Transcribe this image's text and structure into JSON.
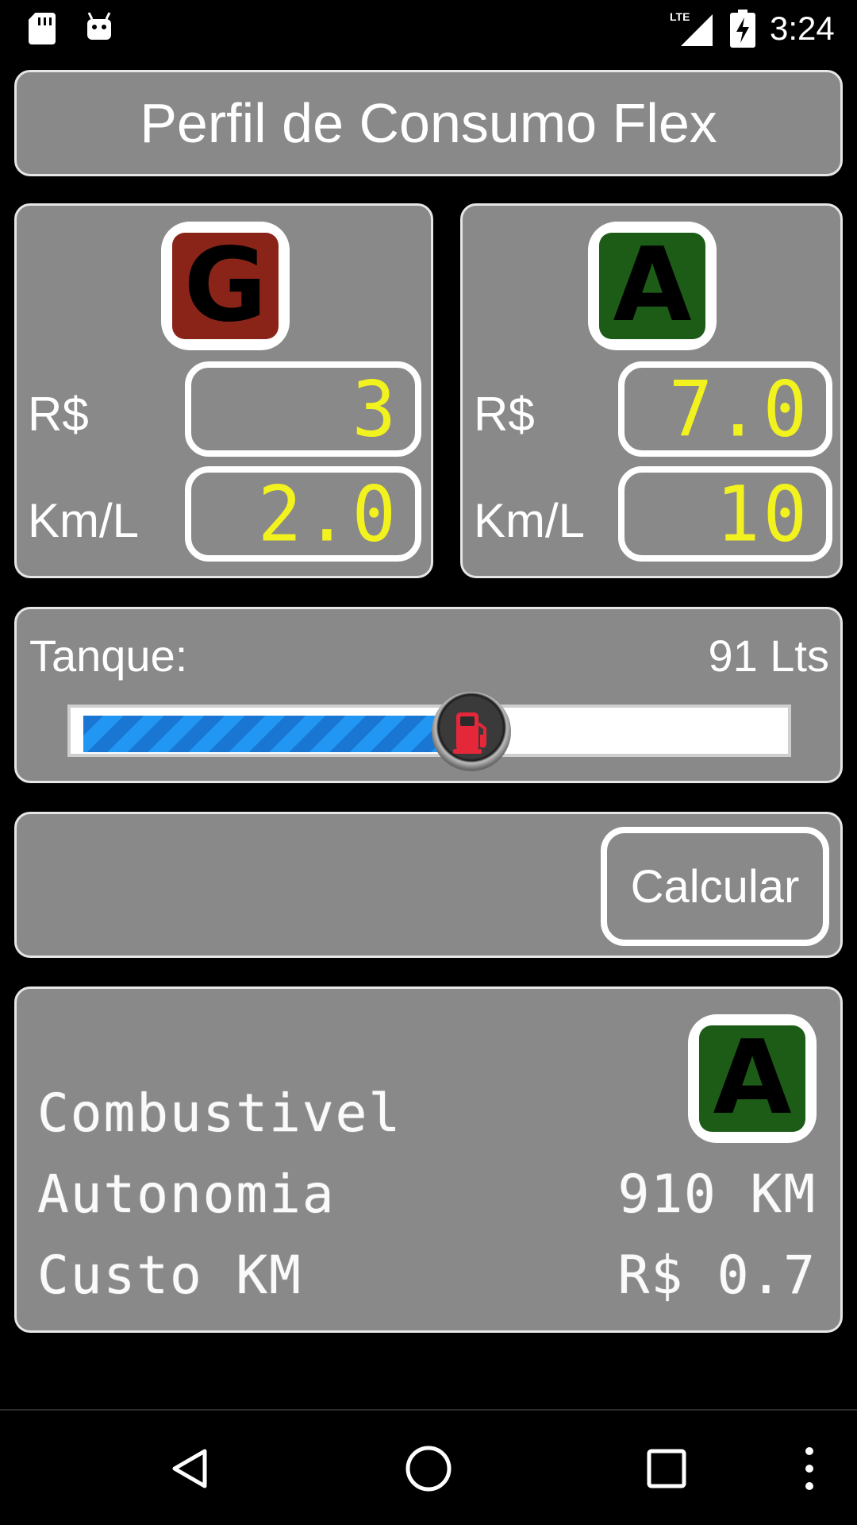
{
  "status_bar": {
    "network": "LTE",
    "time": "3:24"
  },
  "app": {
    "title": "Perfil de Consumo Flex"
  },
  "fuels": {
    "gasoline": {
      "badge_letter": "G",
      "badge_color": "#8b2418",
      "price_label": "R$",
      "price_value": "3",
      "efficiency_label": "Km/L",
      "efficiency_value": "2.0"
    },
    "alcohol": {
      "badge_letter": "A",
      "badge_color": "#1d5c16",
      "price_label": "R$",
      "price_value": "7.0",
      "efficiency_label": "Km/L",
      "efficiency_value": "10"
    }
  },
  "tank": {
    "label": "Tanque:",
    "value_text": "91 Lts",
    "slider_fraction": 0.56,
    "slider_thumb_icon": "fuel-pump-icon",
    "accent_color": "#2196f3"
  },
  "actions": {
    "calculate_label": "Calcular"
  },
  "result": {
    "fuel_label": "Combustivel",
    "fuel_badge_letter": "A",
    "autonomy_label": "Autonomia",
    "autonomy_value": "910 KM",
    "cost_label": "Custo KM",
    "cost_value": "R$ 0.7"
  },
  "nav": {
    "back_icon": "back-triangle-icon",
    "home_icon": "home-circle-icon",
    "recents_icon": "recents-square-icon",
    "menu_icon": "overflow-dots-icon"
  }
}
